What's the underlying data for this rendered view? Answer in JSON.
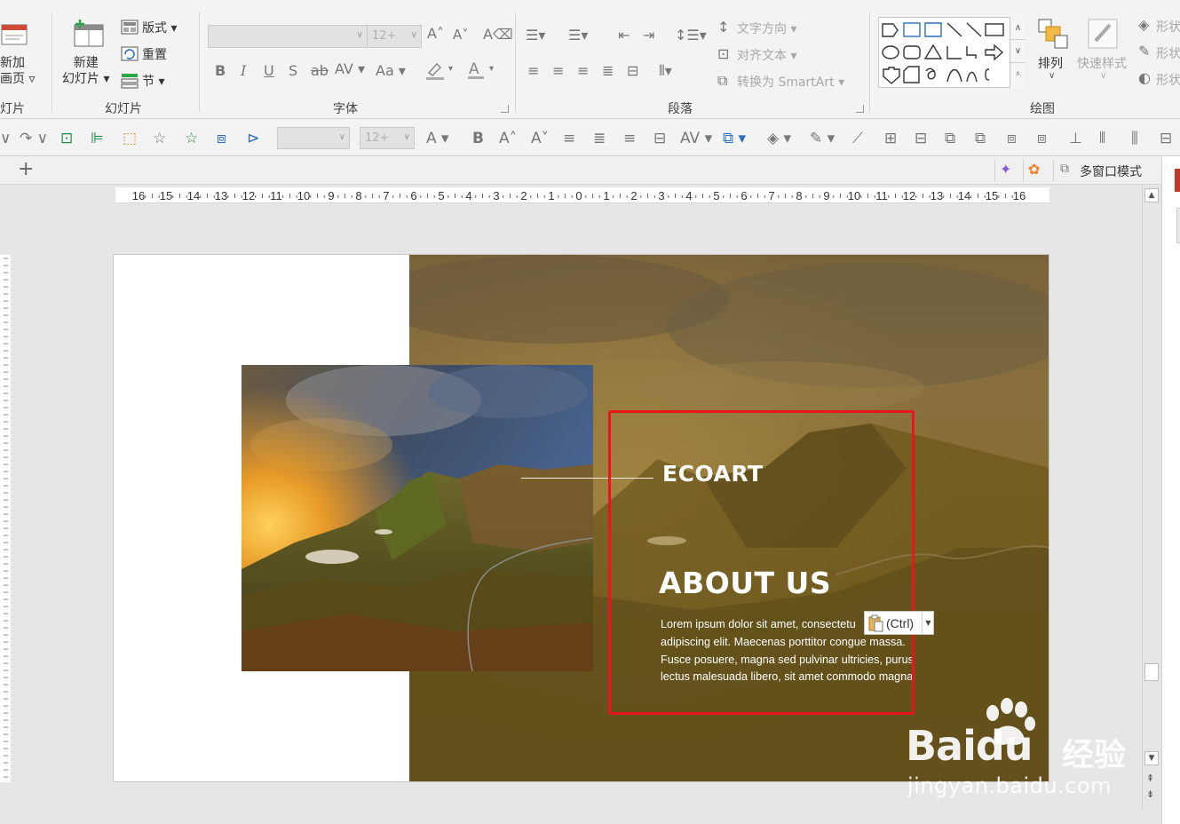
{
  "ribbon": {
    "slides_group": {
      "new_page_label": "新加\n画页 ▿",
      "new_slide_label": "新建\n幻灯片 ▾",
      "layout_label": "版式 ▾",
      "reset_label": "重置",
      "section_label": "节 ▾",
      "group_title": "幻灯片",
      "left_cut_title": "灯片"
    },
    "font_group": {
      "font_size_value": "12+",
      "group_title": "字体"
    },
    "paragraph_group": {
      "text_direction_label": "文字方向 ▾",
      "align_text_label": "对齐文本 ▾",
      "smartart_label": "转换为 SmartArt ▾",
      "group_title": "段落"
    },
    "drawing_group": {
      "arrange_label": "排列",
      "quick_styles_label": "快速样式",
      "shape_fill_label": "形状",
      "shape_outline_label": "形状",
      "shape_effects_label": "形状",
      "group_title": "绘图"
    }
  },
  "qat": {
    "font_size_value": "12+"
  },
  "tabbar": {
    "multi_window_label": "多窗口模式",
    "add_tab_symbol": "+"
  },
  "ruler": {
    "labels": [
      "16",
      "15",
      "14",
      "13",
      "12",
      "11",
      "10",
      "9",
      "8",
      "7",
      "6",
      "5",
      "4",
      "3",
      "2",
      "1",
      "0",
      "1",
      "2",
      "3",
      "4",
      "5",
      "6",
      "7",
      "8",
      "9",
      "10",
      "11",
      "12",
      "13",
      "14",
      "15",
      "16"
    ]
  },
  "slide": {
    "brand": "ECOART",
    "heading": "ABOUT US",
    "body_lines": [
      "Lorem ipsum dolor sit amet, consectetu",
      "adipiscing elit. Maecenas porttitor congue massa.",
      "Fusce posuere, magna sed pulvinar ultricies, purus",
      "lectus malesuada libero, sit amet commodo magna"
    ],
    "paste_ctrl_label": "(Ctrl)"
  },
  "watermark": {
    "brand": "Baidu",
    "suffix": "经验",
    "url": "jingyan.baidu.com"
  },
  "colors": {
    "selection_frame": "#e8161b",
    "ribbon_bg": "#f3f3f3",
    "canvas_bg": "#e6e6e6"
  }
}
